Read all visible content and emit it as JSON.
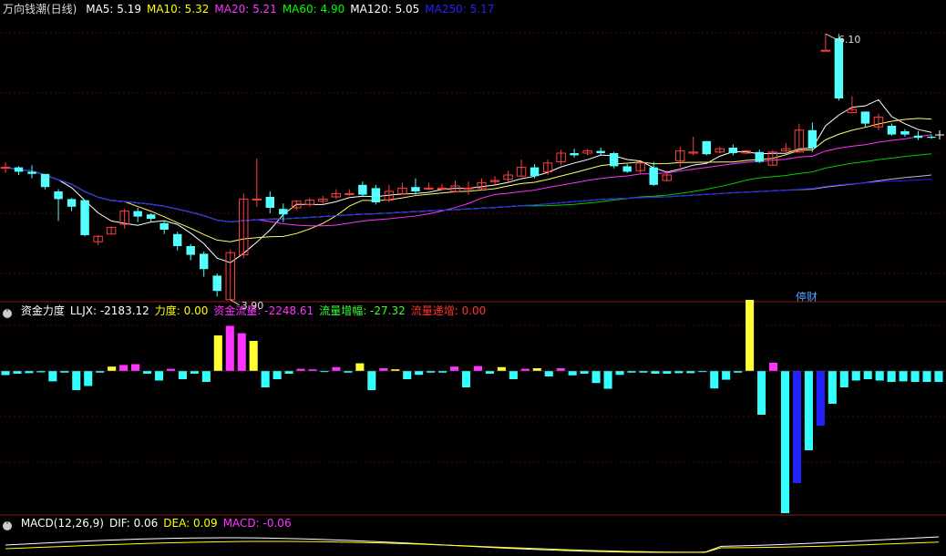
{
  "main_pane": {
    "title": "万向钱潮(日线)",
    "indicators": [
      {
        "label": "MA5: 5.19",
        "color": "#ffffff"
      },
      {
        "label": "MA10: 5.32",
        "color": "#ffff00"
      },
      {
        "label": "MA20: 5.21",
        "color": "#ff33ff"
      },
      {
        "label": "MA60: 4.90",
        "color": "#00ff00"
      },
      {
        "label": "MA120: 5.05",
        "color": "#ffffff"
      },
      {
        "label": "MA250: 5.17",
        "color": "#2222ff"
      }
    ],
    "high_label": "6.10",
    "low_label": "3.90",
    "badge": "停财"
  },
  "flow_pane": {
    "indicators": [
      {
        "label": "资金力度",
        "color": "#ffffff"
      },
      {
        "label": "LLJX: -2183.12",
        "color": "#ffffff"
      },
      {
        "label": "力度: 0.00",
        "color": "#ffff00"
      },
      {
        "label": "资金流量: -2248.61",
        "color": "#ff33ff"
      },
      {
        "label": "流量增幅: -27.32",
        "color": "#33ff33"
      },
      {
        "label": "流量递增: 0.00",
        "color": "#ff3333"
      }
    ]
  },
  "macd_pane": {
    "indicators": [
      {
        "label": "MACD(12,26,9)",
        "color": "#ffffff"
      },
      {
        "label": "DIF: 0.06",
        "color": "#ffffff"
      },
      {
        "label": "DEA: 0.09",
        "color": "#ffff00"
      },
      {
        "label": "MACD: -0.06",
        "color": "#ff33ff"
      }
    ]
  },
  "chart_data": [
    {
      "type": "candlestick",
      "title": "万向钱潮(日线)",
      "ylim": [
        3.7,
        6.3
      ],
      "candles": [
        [
          4.92,
          4.92,
          4.97,
          4.87
        ],
        [
          4.92,
          4.88,
          4.93,
          4.85
        ],
        [
          4.88,
          4.86,
          4.94,
          4.82
        ],
        [
          4.86,
          4.74,
          4.86,
          4.72
        ],
        [
          4.7,
          4.63,
          4.72,
          4.43
        ],
        [
          4.63,
          4.56,
          4.64,
          4.52
        ],
        [
          4.62,
          4.3,
          4.62,
          4.29
        ],
        [
          4.24,
          4.29,
          4.3,
          4.21
        ],
        [
          4.31,
          4.37,
          4.38,
          4.31
        ],
        [
          4.4,
          4.52,
          4.54,
          4.36
        ],
        [
          4.52,
          4.47,
          4.55,
          4.42
        ],
        [
          4.49,
          4.45,
          4.5,
          4.42
        ],
        [
          4.41,
          4.35,
          4.43,
          4.31
        ],
        [
          4.31,
          4.2,
          4.33,
          4.16
        ],
        [
          4.2,
          4.12,
          4.22,
          4.07
        ],
        [
          4.13,
          3.99,
          4.15,
          3.92
        ],
        [
          3.93,
          3.79,
          3.95,
          3.74
        ],
        [
          3.71,
          4.14,
          4.17,
          3.71
        ],
        [
          4.12,
          4.63,
          4.68,
          4.09
        ],
        [
          4.63,
          4.63,
          5.0,
          4.56
        ],
        [
          4.65,
          4.55,
          4.7,
          4.5
        ],
        [
          4.54,
          4.49,
          4.59,
          4.42
        ],
        [
          4.55,
          4.61,
          4.62,
          4.53
        ],
        [
          4.58,
          4.62,
          4.64,
          4.56
        ],
        [
          4.61,
          4.63,
          4.66,
          4.59
        ],
        [
          4.65,
          4.68,
          4.72,
          4.63
        ],
        [
          4.68,
          4.68,
          4.72,
          4.66
        ],
        [
          4.76,
          4.67,
          4.79,
          4.66
        ],
        [
          4.73,
          4.6,
          4.76,
          4.58
        ],
        [
          4.62,
          4.7,
          4.76,
          4.6
        ],
        [
          4.68,
          4.73,
          4.78,
          4.67
        ],
        [
          4.74,
          4.7,
          4.82,
          4.67
        ],
        [
          4.73,
          4.73,
          4.78,
          4.71
        ],
        [
          4.72,
          4.73,
          4.77,
          4.71
        ],
        [
          4.7,
          4.75,
          4.8,
          4.69
        ],
        [
          4.73,
          4.73,
          4.79,
          4.67
        ],
        [
          4.73,
          4.78,
          4.82,
          4.71
        ],
        [
          4.79,
          4.8,
          4.84,
          4.76
        ],
        [
          4.81,
          4.85,
          4.89,
          4.79
        ],
        [
          4.84,
          4.92,
          4.99,
          4.84
        ],
        [
          4.92,
          4.84,
          4.95,
          4.82
        ],
        [
          4.88,
          4.96,
          4.99,
          4.85
        ],
        [
          4.97,
          5.05,
          5.08,
          4.94
        ],
        [
          5.05,
          5.03,
          5.09,
          5.01
        ],
        [
          5.05,
          5.07,
          5.09,
          5.03
        ],
        [
          5.07,
          5.05,
          5.1,
          5.03
        ],
        [
          5.05,
          4.93,
          5.06,
          4.91
        ],
        [
          4.93,
          4.88,
          4.95,
          4.87
        ],
        [
          4.89,
          4.96,
          4.97,
          4.86
        ],
        [
          4.92,
          4.76,
          4.97,
          4.75
        ],
        [
          4.8,
          4.85,
          4.89,
          4.79
        ],
        [
          4.98,
          5.07,
          5.11,
          4.92
        ],
        [
          5.05,
          5.06,
          5.2,
          5.03
        ],
        [
          5.16,
          5.04,
          5.16,
          5.03
        ],
        [
          5.06,
          5.09,
          5.11,
          5.05
        ],
        [
          5.1,
          5.05,
          5.13,
          5.03
        ],
        [
          5.05,
          5.07,
          5.08,
          5.04
        ],
        [
          5.06,
          4.97,
          5.08,
          4.96
        ],
        [
          4.94,
          5.06,
          5.08,
          4.94
        ],
        [
          5.07,
          5.09,
          5.14,
          5.06
        ],
        [
          5.06,
          5.26,
          5.32,
          5.06
        ],
        [
          5.26,
          5.1,
          5.33,
          5.06
        ],
        [
          5.99,
          5.99,
          6.14,
          5.99
        ],
        [
          6.1,
          5.55,
          6.14,
          5.53
        ],
        [
          5.42,
          5.45,
          5.57,
          5.43
        ],
        [
          5.43,
          5.32,
          5.43,
          5.29
        ],
        [
          5.29,
          5.38,
          5.41,
          5.26
        ],
        [
          5.3,
          5.22,
          5.32,
          5.21
        ],
        [
          5.25,
          5.22,
          5.27,
          5.2
        ],
        [
          5.21,
          5.19,
          5.25,
          5.17
        ],
        [
          5.2,
          5.19,
          5.22,
          5.18
        ]
      ]
    },
    {
      "type": "bar",
      "title": "资金力度",
      "series": [
        {
          "name": "资金流量",
          "values": [
            -15,
            -10,
            -8,
            -5,
            -38,
            -6,
            -70,
            -55,
            -6,
            16,
            22,
            25,
            -10,
            -35,
            8,
            -30,
            -10,
            -40,
            130,
            165,
            138,
            110,
            -60,
            -30,
            -10,
            8,
            6,
            -4,
            14,
            -6,
            28,
            -70,
            10,
            6,
            -30,
            -14,
            -6,
            -6,
            16,
            -60,
            18,
            -10,
            14,
            -30,
            8,
            10,
            -20,
            10,
            -16,
            -10,
            -44,
            -65,
            -14,
            -6,
            -6,
            -10,
            -10,
            -8,
            -8,
            -4,
            -64,
            -32,
            -6,
            260,
            -160,
            30,
            -520,
            -410,
            -290,
            -200,
            -120,
            -60,
            -35,
            -30,
            -35,
            -40,
            -38,
            -40,
            -40,
            -40
          ]
        }
      ]
    },
    {
      "type": "line",
      "title": "MACD(12,26,9)",
      "series": [
        {
          "name": "DIF",
          "values": [
            0.06
          ]
        },
        {
          "name": "DEA",
          "values": [
            0.09
          ]
        },
        {
          "name": "MACD",
          "values": [
            -0.06
          ]
        }
      ]
    }
  ]
}
